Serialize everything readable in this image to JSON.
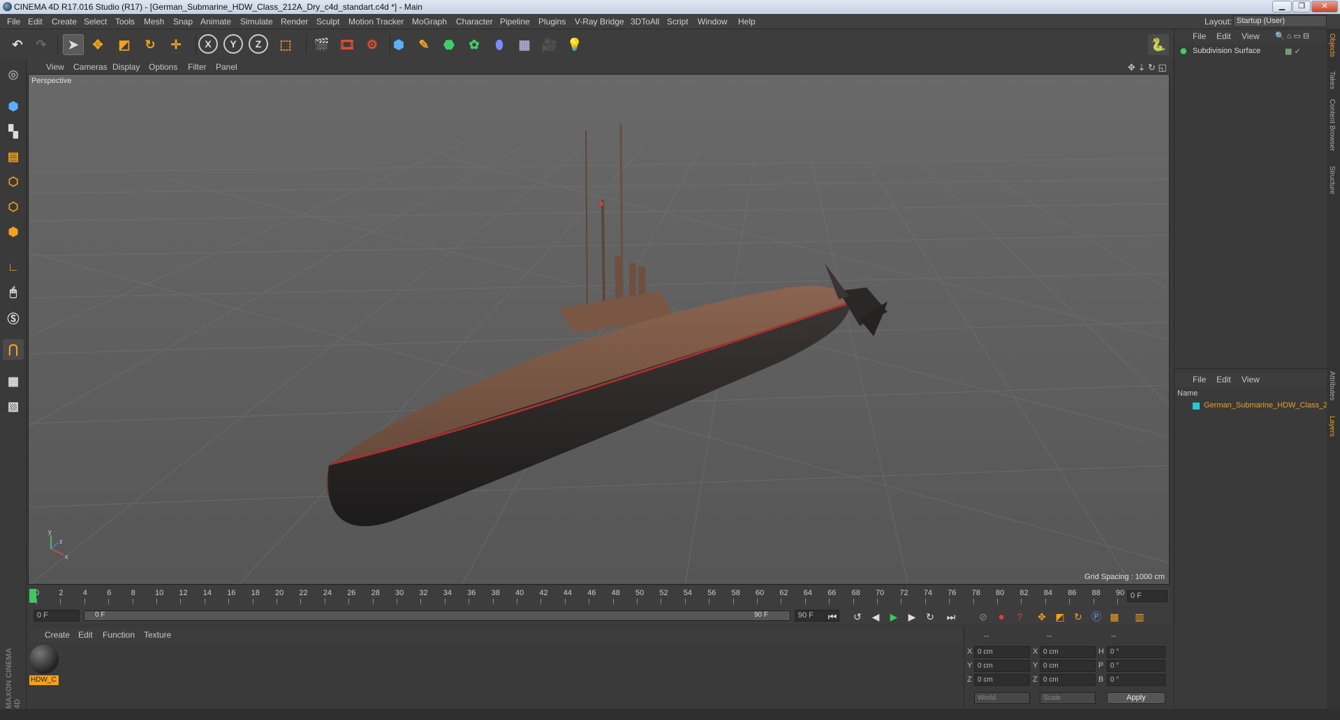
{
  "window": {
    "title": "CINEMA 4D R17.016 Studio (R17) - [German_Submarine_HDW_Class_212A_Dry_c4d_standart.c4d *] - Main",
    "minimize": "▁",
    "maximize": "❐",
    "close": "✕"
  },
  "menubar": {
    "items": [
      "File",
      "Edit",
      "Create",
      "Select",
      "Tools",
      "Mesh",
      "Snap",
      "Animate",
      "Simulate",
      "Render",
      "Sculpt",
      "Motion Tracker",
      "MoGraph",
      "Character",
      "Pipeline",
      "Plugins",
      "V-Ray Bridge",
      "3DToAll",
      "Script",
      "Window",
      "Help"
    ],
    "layout_label": "Layout:",
    "layout_value": "Startup (User)"
  },
  "toolbar": {
    "icons": [
      "undo-icon",
      "redo-icon",
      "select-arrow-icon",
      "move-icon",
      "scale-icon",
      "rotate-icon",
      "transform-icon",
      "x-axis-icon",
      "y-axis-icon",
      "z-axis-icon",
      "coordinate-system-icon",
      "render-view-icon",
      "render-picture-viewer-icon",
      "render-settings-icon",
      "cube-icon",
      "pen-icon",
      "subdivision-icon",
      "cloner-icon",
      "deformer-icon",
      "floor-icon",
      "camera-icon",
      "light-icon"
    ],
    "axis_labels": [
      "X",
      "Y",
      "Z"
    ],
    "python_icon": "python-icon"
  },
  "viewport": {
    "menu": [
      "View",
      "Cameras",
      "Display",
      "Options",
      "Filter",
      "Panel"
    ],
    "label": "Perspective",
    "grid_spacing": "Grid Spacing : 1000 cm",
    "background_color": "#5d5d5d",
    "axis_labels": [
      "y",
      "x",
      "z"
    ]
  },
  "timeline": {
    "ticks": [
      "0",
      "2",
      "4",
      "6",
      "8",
      "10",
      "12",
      "14",
      "16",
      "18",
      "20",
      "22",
      "24",
      "26",
      "28",
      "30",
      "32",
      "34",
      "36",
      "38",
      "40",
      "42",
      "44",
      "46",
      "48",
      "50",
      "52",
      "54",
      "56",
      "58",
      "60",
      "62",
      "64",
      "66",
      "68",
      "70",
      "72",
      "74",
      "76",
      "78",
      "80",
      "82",
      "84",
      "86",
      "88",
      "90"
    ],
    "current_frame": "0 F"
  },
  "frame_controls": {
    "start": "0 F",
    "range_start": "0 F",
    "range_end": "90 F",
    "end": "90 F"
  },
  "material_manager": {
    "menu": [
      "Create",
      "Edit",
      "Function",
      "Texture"
    ],
    "material_name": "HDW_C"
  },
  "coordinates": {
    "header": [
      "--",
      "--",
      "--"
    ],
    "rows": [
      {
        "a": "X",
        "av": "0 cm",
        "b": "X",
        "bv": "0 cm",
        "c": "H",
        "cv": "0 °"
      },
      {
        "a": "Y",
        "av": "0 cm",
        "b": "Y",
        "bv": "0 cm",
        "c": "P",
        "cv": "0 °"
      },
      {
        "a": "Z",
        "av": "0 cm",
        "b": "Z",
        "bv": "0 cm",
        "c": "B",
        "cv": "0 °"
      }
    ],
    "world": "World",
    "scale": "Scale",
    "apply": "Apply"
  },
  "objects_panel": {
    "menu": [
      "File",
      "Edit",
      "View"
    ],
    "item": "Subdivision Surface"
  },
  "layers_panel": {
    "menu": [
      "File",
      "Edit",
      "View"
    ],
    "column": "Name",
    "item": "German_Submarine_HDW_Class_2",
    "item_color": "#2ac6d6"
  },
  "side_tabs": [
    "Objects",
    "Takes",
    "Content Browser",
    "Structure",
    "Attributes",
    "Layers"
  ],
  "brand": "MAXON CINEMA 4D",
  "colors": {
    "accent": "#f2a21d",
    "selected_text": "#f0a020"
  }
}
